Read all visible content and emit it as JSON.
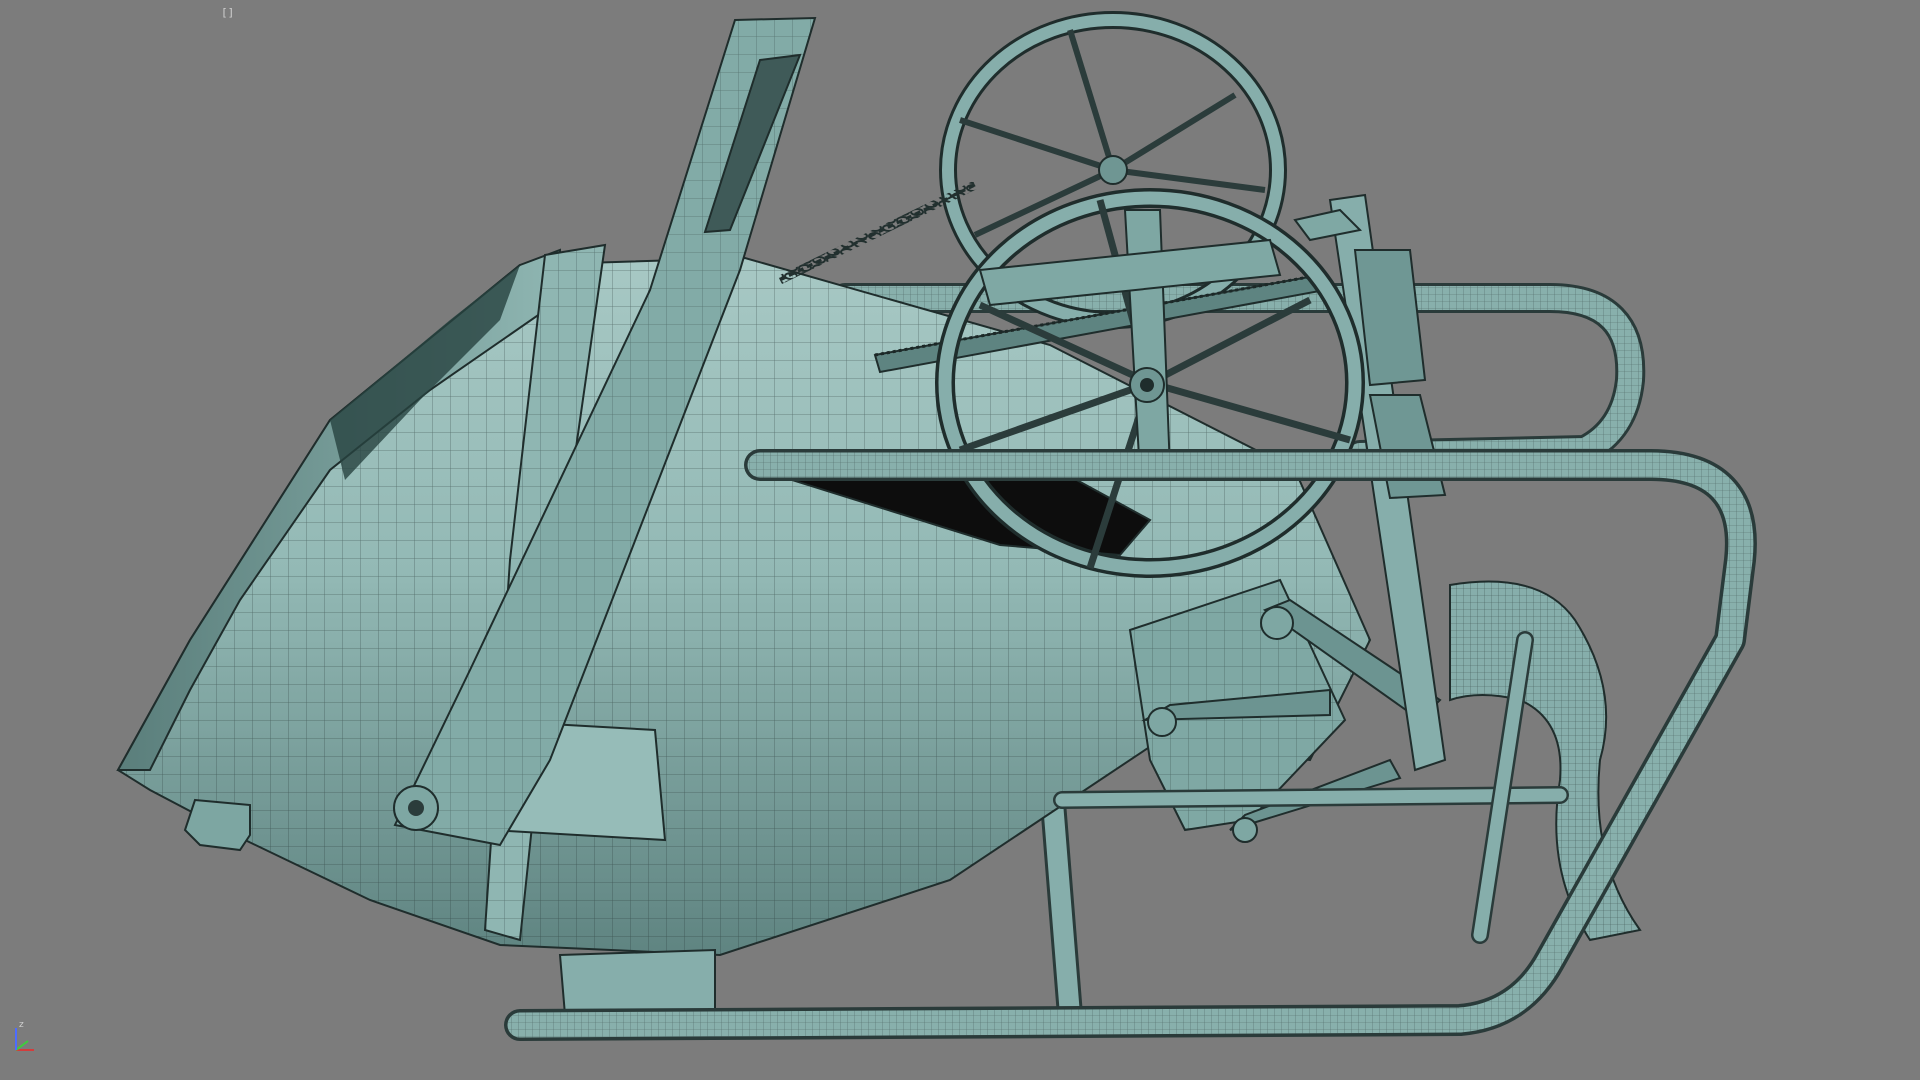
{
  "viewport": {
    "label": "[]",
    "background": "#7c7c7c",
    "render_mode": "shaded-with-wireframe"
  },
  "model": {
    "description_icon": "concrete-bucket-model",
    "colors": {
      "surface": "#86aeab",
      "surface_light": "#a9c9c5",
      "surface_shadow": "#4d6d6b",
      "wire": "#1f2d2c"
    }
  },
  "axis_gizmo": {
    "z_label": "z",
    "colors": {
      "x": "#d43c3c",
      "y": "#3ccf3c",
      "z": "#4d6cff"
    }
  }
}
